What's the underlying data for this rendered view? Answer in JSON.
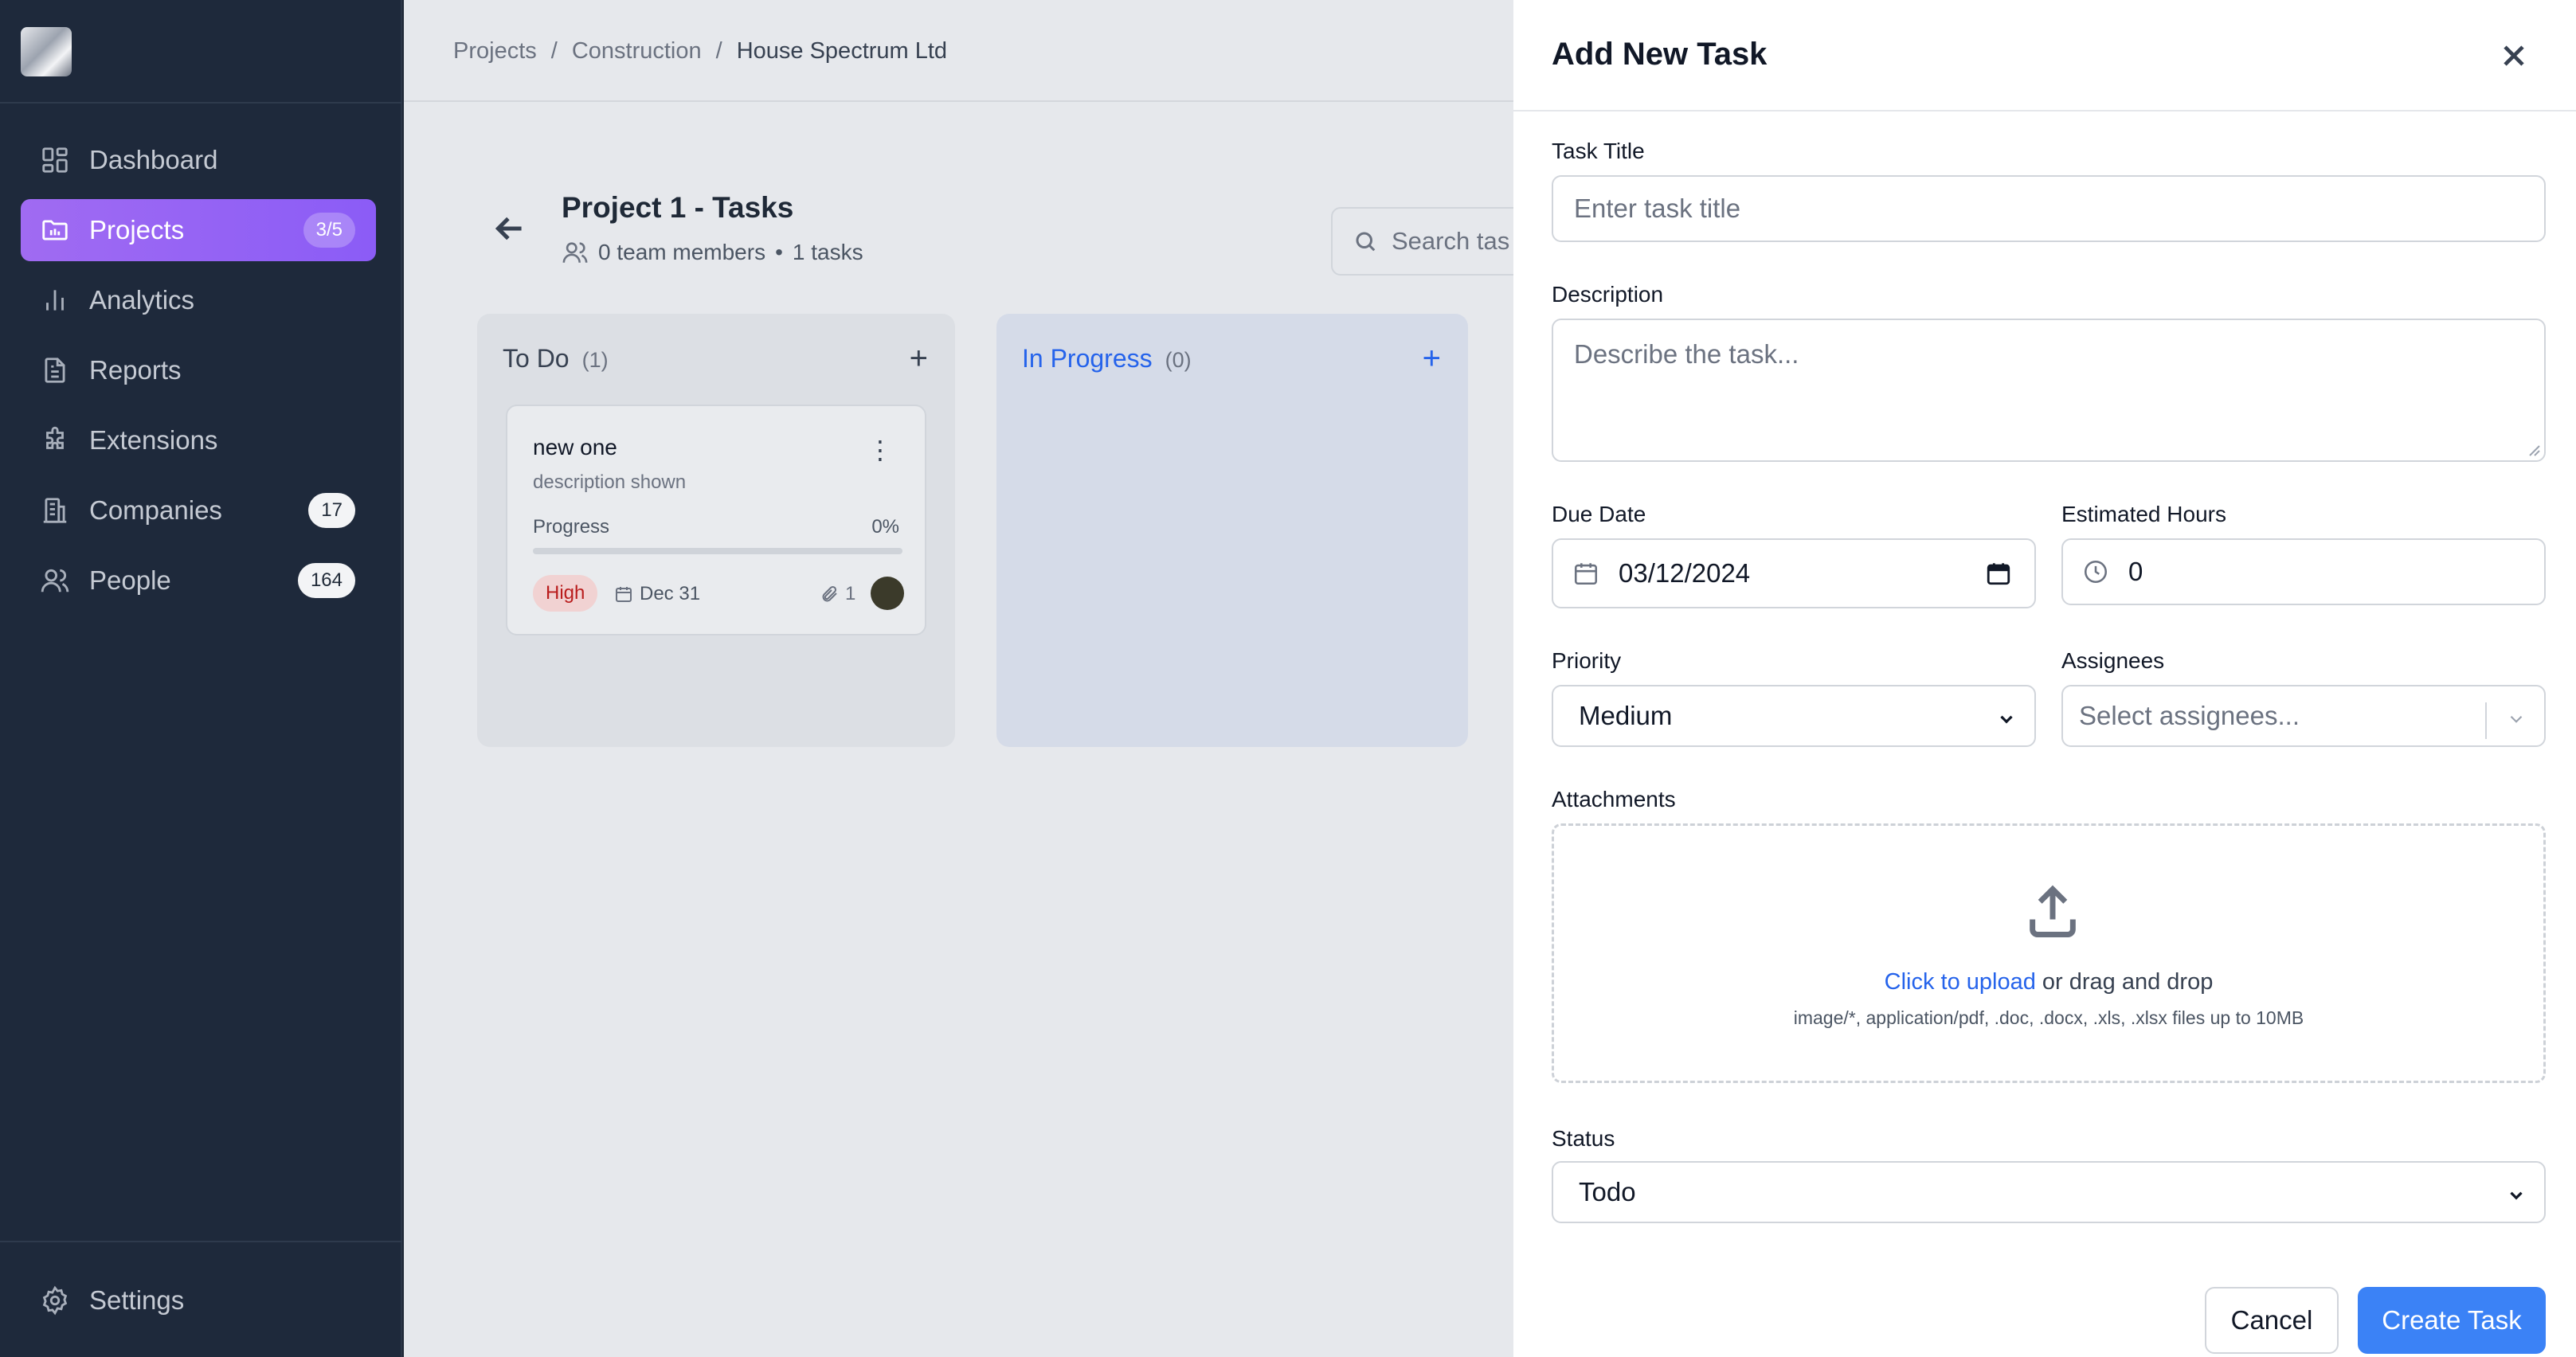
{
  "sidebar": {
    "items": [
      {
        "label": "Dashboard",
        "icon": "dashboard-icon"
      },
      {
        "label": "Projects",
        "icon": "folder-icon",
        "badge": "3/5",
        "active": true
      },
      {
        "label": "Analytics",
        "icon": "bar-chart-icon"
      },
      {
        "label": "Reports",
        "icon": "file-icon"
      },
      {
        "label": "Extensions",
        "icon": "puzzle-icon"
      },
      {
        "label": "Companies",
        "icon": "building-icon",
        "badge": "17"
      },
      {
        "label": "People",
        "icon": "users-icon",
        "badge": "164"
      }
    ],
    "settings_label": "Settings"
  },
  "breadcrumb": [
    "Projects",
    "/",
    "Construction",
    "/",
    "House Spectrum Ltd"
  ],
  "project": {
    "title": "Project 1 - Tasks",
    "members": "0 team members",
    "dot": "•",
    "tasks": "1 tasks",
    "search_placeholder": "Search tas"
  },
  "columns": [
    {
      "title": "To Do",
      "count": "(1)",
      "add": "+"
    },
    {
      "title": "In Progress",
      "count": "(0)",
      "add": "+"
    }
  ],
  "card": {
    "title": "new one",
    "description": "description shown",
    "progress_label": "Progress",
    "progress_value": "0%",
    "progress_fraction": 0,
    "priority": "High",
    "due": "Dec 31",
    "attachments": "1",
    "menu": "⋮"
  },
  "modal": {
    "title": "Add New Task",
    "task_title_label": "Task Title",
    "task_title_placeholder": "Enter task title",
    "description_label": "Description",
    "description_placeholder": "Describe the task...",
    "due_date_label": "Due Date",
    "due_date_value": "03/12/2024",
    "est_hours_label": "Estimated Hours",
    "est_hours_value": "0",
    "priority_label": "Priority",
    "priority_value": "Medium",
    "assignees_label": "Assignees",
    "assignees_placeholder": "Select assignees...",
    "attachments_label": "Attachments",
    "upload_link": "Click to upload",
    "upload_rest": " or drag and drop",
    "upload_hint": "image/*, application/pdf, .doc, .docx, .xls, .xlsx files up to 10MB",
    "status_label": "Status",
    "status_value": "Todo",
    "cancel_label": "Cancel",
    "create_label": "Create Task"
  },
  "colors": {
    "accent": "#8b5cf6",
    "primary_button": "#3b82f6",
    "sidebar_bg": "#1e293b",
    "in_progress": "#2563eb",
    "priority_high": "#b91c1c"
  }
}
